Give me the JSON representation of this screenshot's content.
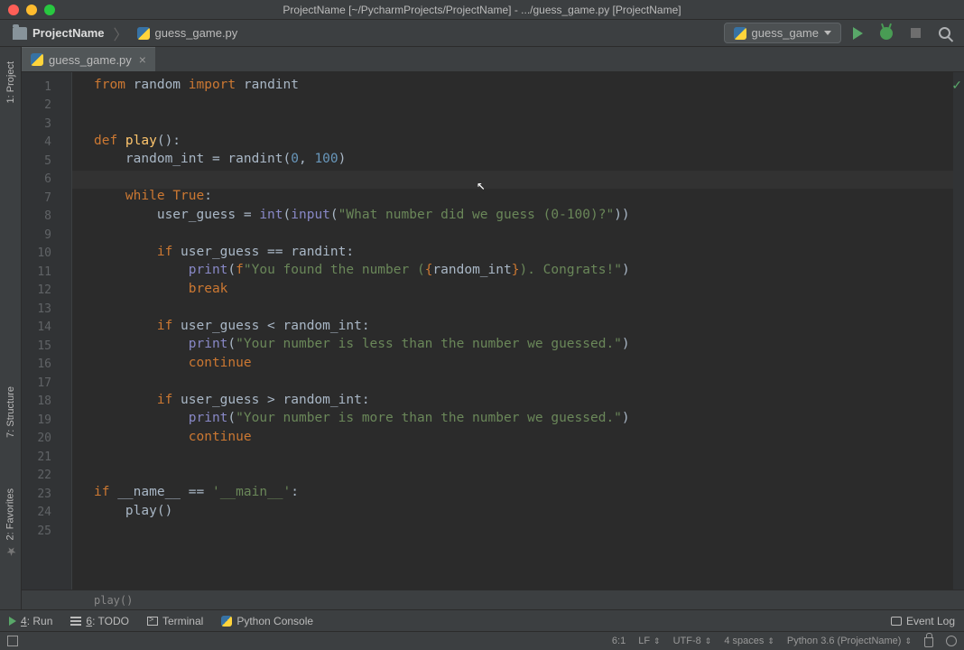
{
  "title": "ProjectName [~/PycharmProjects/ProjectName] - .../guess_game.py [ProjectName]",
  "breadcrumb": {
    "project": "ProjectName",
    "file": "guess_game.py"
  },
  "run_config": "guess_game",
  "left_tabs": {
    "project": "1: Project",
    "structure": "7: Structure",
    "favorites": "2: Favorites"
  },
  "editor_tab": "guess_game.py",
  "lines": [
    "1",
    "2",
    "3",
    "4",
    "5",
    "6",
    "7",
    "8",
    "9",
    "10",
    "11",
    "12",
    "13",
    "14",
    "15",
    "16",
    "17",
    "18",
    "19",
    "20",
    "21",
    "22",
    "23",
    "24",
    "25"
  ],
  "code": {
    "l1_from": "from ",
    "l1_mod": "random ",
    "l1_imp": "import ",
    "l1_name": "randint",
    "l4_def": "def ",
    "l4_fn": "play",
    "l4_rest": "():",
    "l5": "    random_int = randint(",
    "l5_a": "0",
    "l5_c": ", ",
    "l5_b": "100",
    "l5_end": ")",
    "l7_w": "    while ",
    "l7_t": "True",
    "l7_e": ":",
    "l8_a": "        user_guess = ",
    "l8_int": "int",
    "l8_p": "(",
    "l8_inp": "input",
    "l8_p2": "(",
    "l8_s": "\"What number did we guess (0-100)?\"",
    "l8_end": "))",
    "l10_if": "        if ",
    "l10_r": "user_guess == randint:",
    "l11_a": "            ",
    "l11_pr": "print",
    "l11_p": "(",
    "l11_f": "f",
    "l11_s1": "\"You found the number (",
    "l11_b": "{",
    "l11_e": "random_int",
    "l11_b2": "}",
    "l11_s2": "). Congrats!\"",
    "l11_end": ")",
    "l12": "            ",
    "l12_b": "break",
    "l14_if": "        if ",
    "l14_r": "user_guess < random_int:",
    "l15_a": "            ",
    "l15_pr": "print",
    "l15_p": "(",
    "l15_s": "\"Your number is less than the number we guessed.\"",
    "l15_end": ")",
    "l16": "            ",
    "l16_c": "continue",
    "l18_if": "        if ",
    "l18_r": "user_guess > random_int:",
    "l19_a": "            ",
    "l19_pr": "print",
    "l19_p": "(",
    "l19_s": "\"Your number is more than the number we guessed.\"",
    "l19_end": ")",
    "l20": "            ",
    "l20_c": "continue",
    "l23_if": "if ",
    "l23_n": "__name__ == ",
    "l23_s": "'__main__'",
    "l23_e": ":",
    "l24": "    play()"
  },
  "crumb_fn": "play()",
  "bottom": {
    "run": "4: Run",
    "todo": "6: TODO",
    "terminal": "Terminal",
    "pyconsole": "Python Console",
    "eventlog": "Event Log"
  },
  "status": {
    "pos": "6:1",
    "le": "LF",
    "enc": "UTF-8",
    "indent": "4 spaces",
    "interp": "Python 3.6 (ProjectName)"
  }
}
